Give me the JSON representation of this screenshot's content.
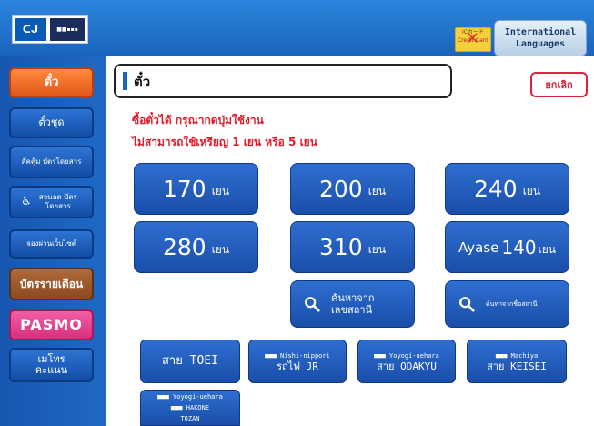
{
  "header": {
    "logo_mark": "ᑕᒍ",
    "logo_sub": "■■▪▪▪",
    "ic_card_text": "ICカード Credit Card",
    "language_btn_line1": "International",
    "language_btn_line2": "Languages"
  },
  "sidebar": {
    "items": [
      {
        "label": "ตั๋ว"
      },
      {
        "label": "ตั๋วชุด"
      },
      {
        "label": "สัคคุ้ม บัตรโดยสาร"
      },
      {
        "label": "สวนลด บัตรโดยสาร"
      },
      {
        "label": "จองผ่านเว็บไซต์"
      },
      {
        "label": "บัตรรายเดือน"
      },
      {
        "label": "PASMO"
      },
      {
        "label": "เมโทร คะแนน"
      }
    ]
  },
  "main": {
    "title": "ตั๋ว",
    "cancel_label": "ยกเลิก",
    "instruction_1": "ซื้อตั๋วได้ กรุณากดปุ่มใช้งาน",
    "instruction_2": "ไม่สามารถใช้เหรียญ 1 เยน หรือ 5 เยน",
    "fares": [
      {
        "amount": "170",
        "unit": "เยน"
      },
      {
        "amount": "200",
        "unit": "เยน"
      },
      {
        "amount": "240",
        "unit": "เยน"
      },
      {
        "amount": "280",
        "unit": "เยน"
      },
      {
        "amount": "310",
        "unit": "เยน"
      },
      {
        "name": "Ayase",
        "amount": "140",
        "unit": "เยน"
      }
    ],
    "search_by_number": "ค้นหาจาก เลขสถานี",
    "search_by_name": "ค้นหาจากชื่อสถานี",
    "lines": [
      {
        "top": "",
        "bottom": "สาย TOEI"
      },
      {
        "top": "■■■ Nishi-nippori",
        "bottom": "รถไฟ JR"
      },
      {
        "top": "■■■ Yoyogi-uehara",
        "bottom": "สาย ODAKYU"
      },
      {
        "top": "■■■ Machiya",
        "bottom": "สาย KEISEI"
      },
      {
        "top": "■■■ Yoyogi-uehara",
        "middle": "■■■ HAKONE",
        "bottom": "TOZAN"
      }
    ]
  },
  "colors": {
    "header_blue": "#1a63bd",
    "button_blue": "#1a4eaa",
    "active_orange": "#e2561a",
    "pasmo_pink": "#d8307e",
    "alert_red": "#e11b2a"
  }
}
